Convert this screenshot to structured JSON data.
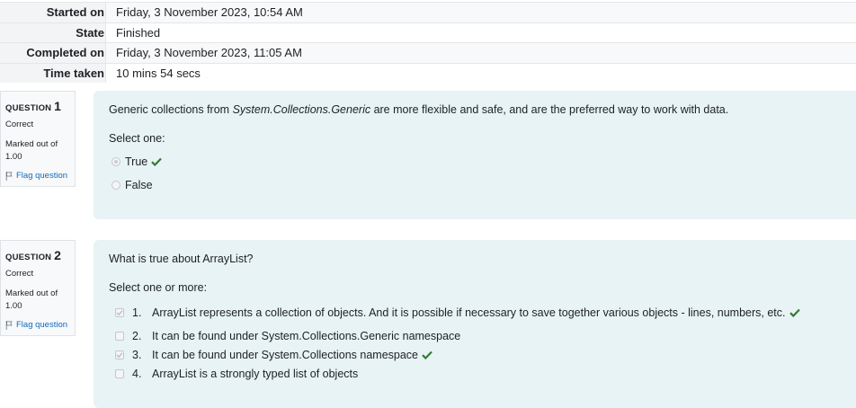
{
  "summary": [
    {
      "label": "Started on",
      "value": "Friday, 3 November 2023, 10:54 AM"
    },
    {
      "label": "State",
      "value": "Finished"
    },
    {
      "label": "Completed on",
      "value": "Friday, 3 November 2023, 11:05 AM"
    },
    {
      "label": "Time taken",
      "value": "10 mins 54 secs"
    }
  ],
  "colors": {
    "correct": "#357a32",
    "link": "#0f6cbf",
    "content_bg": "#e7f3f5"
  },
  "questions": [
    {
      "label": "QUESTION",
      "number": "1",
      "state": "Correct",
      "grade": "Marked out of 1.00",
      "flag": "Flag question",
      "text_prefix": "Generic collections from ",
      "text_italic": "System.Collections.Generic",
      "text_suffix": " are more flexible and safe, and are the preferred way to work with data.",
      "prompt": "Select one:",
      "answers": [
        {
          "text": "True",
          "checked": true,
          "correct_mark": true
        },
        {
          "text": "False",
          "checked": false,
          "correct_mark": false
        }
      ]
    },
    {
      "label": "QUESTION",
      "number": "2",
      "state": "Correct",
      "grade": "Marked out of 1.00",
      "flag": "Flag question",
      "text": "What is true about ArrayList?",
      "prompt": "Select one or more:",
      "answers": [
        {
          "num": "1.",
          "text": "ArrayList represents a collection of objects. And it is possible if necessary to save together various objects - lines, numbers, etc.",
          "checked": true,
          "correct_mark": true
        },
        {
          "num": "2.",
          "text": "It can be found under System.Collections.Generic namespace",
          "checked": false,
          "correct_mark": false
        },
        {
          "num": "3.",
          "text": "It can be found under System.Collections namespace",
          "checked": true,
          "correct_mark": true
        },
        {
          "num": "4.",
          "text": "ArrayList is a strongly typed list of objects",
          "checked": false,
          "correct_mark": false
        }
      ]
    }
  ]
}
